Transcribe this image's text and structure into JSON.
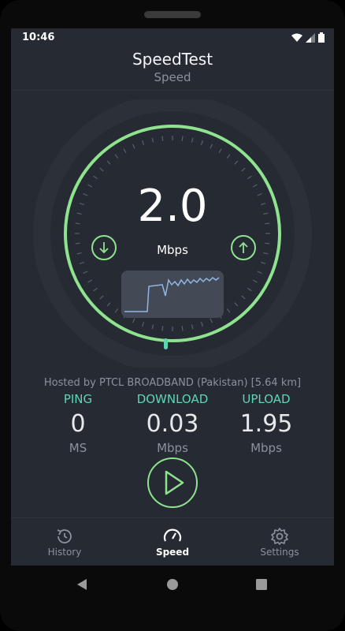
{
  "status": {
    "time": "10:46"
  },
  "header": {
    "title": "SpeedTest",
    "subtitle": "Speed"
  },
  "gauge": {
    "value": "2.0",
    "unit": "Mbps",
    "download_icon": "arrow-down-circle-icon",
    "upload_icon": "arrow-up-circle-icon"
  },
  "server": {
    "hosted": "Hosted by PTCL BROADBAND (Pakistan) [5.64 km]"
  },
  "stats": {
    "ping": {
      "label": "PING",
      "value": "0",
      "unit": "MS"
    },
    "download": {
      "label": "DOWNLOAD",
      "value": "0.03",
      "unit": "Mbps"
    },
    "upload": {
      "label": "UPLOAD",
      "value": "1.95",
      "unit": "Mbps"
    }
  },
  "nav": {
    "history": "History",
    "speed": "Speed",
    "settings": "Settings"
  },
  "colors": {
    "accent": "#8fe38f",
    "teal": "#5fd6b3",
    "background": "#252a33"
  }
}
